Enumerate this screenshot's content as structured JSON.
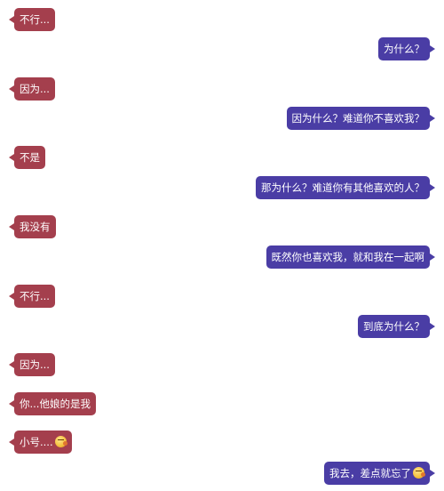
{
  "conversation": {
    "colors": {
      "left_bubble": "#a43f4d",
      "right_bubble": "#4a3da5",
      "text": "#ffffff",
      "background": "#ffffff"
    },
    "messages": [
      {
        "side": "left",
        "text": "不行..."
      },
      {
        "side": "right",
        "text": "为什么？"
      },
      {
        "side": "left",
        "text": "因为..."
      },
      {
        "side": "right",
        "text": "因为什么？难道你不喜欢我？"
      },
      {
        "side": "left",
        "text": "不是"
      },
      {
        "side": "right",
        "text": "那为什么？难道你有其他喜欢的人？"
      },
      {
        "side": "left",
        "text": "我没有"
      },
      {
        "side": "right",
        "text": "既然你也喜欢我，就和我在一起啊"
      },
      {
        "side": "left",
        "text": "不行..."
      },
      {
        "side": "right",
        "text": "到底为什么？"
      },
      {
        "side": "left",
        "text": "因为..."
      },
      {
        "side": "left",
        "text": "你...他娘的是我"
      },
      {
        "side": "left",
        "text": "小号....",
        "icon": "sweat-smile-emoji-icon"
      },
      {
        "side": "right",
        "text": "我去，差点就忘了",
        "icon": "sweat-smile-emoji-icon"
      }
    ]
  }
}
